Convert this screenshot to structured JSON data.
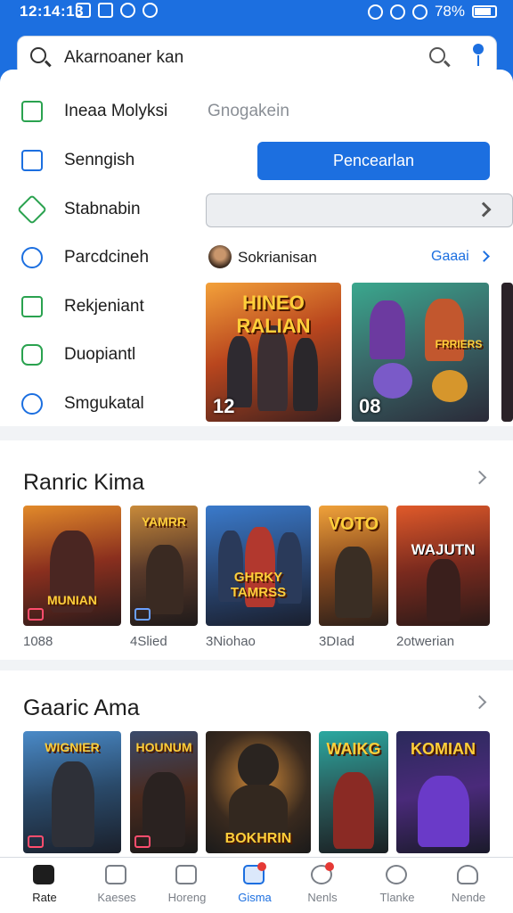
{
  "status": {
    "time": "12:14:13",
    "battery": "78%"
  },
  "search": {
    "value": "Akarnoaner kan"
  },
  "menu": [
    {
      "label": "Ineaa Molyksi",
      "icon": "home-icon"
    },
    {
      "label": "Senngish",
      "icon": "bag-icon"
    },
    {
      "label": "Stabnabin",
      "icon": "send-icon"
    },
    {
      "label": "Parcdcineh",
      "icon": "compass-icon"
    },
    {
      "label": "Rekjeniant",
      "icon": "folder-icon"
    },
    {
      "label": "Duopiantl",
      "icon": "badge-icon"
    },
    {
      "label": "Smgukatal",
      "icon": "location-icon"
    }
  ],
  "right": {
    "ghost": "Gnogakein",
    "primary": "Pencearlan",
    "publisher": "Sokrianisan",
    "more": "Gaaai"
  },
  "featured": [
    {
      "title": "HINEO RALIAN",
      "num": "12"
    },
    {
      "title": "FRRIERS",
      "num": "08"
    }
  ],
  "section1": {
    "title": "Ranric Kima",
    "items": [
      {
        "title": "MUNIAN",
        "caption": "1088"
      },
      {
        "title": "YAMRR",
        "caption": "4Slied"
      },
      {
        "title": "GHRKY TAMRSS",
        "caption": "3Niohao"
      },
      {
        "title": "VOTO",
        "caption": "3DIad"
      },
      {
        "title": "WAJUTN",
        "caption": "2otwerian"
      }
    ]
  },
  "section2": {
    "title": "Gaaric Ama",
    "items": [
      {
        "title": "WIGNIER"
      },
      {
        "title": "HOUNUM"
      },
      {
        "title": "BOKHRIN"
      },
      {
        "title": "WAIKG"
      },
      {
        "title": "KOMIAN"
      }
    ]
  },
  "nav": [
    {
      "label": "Rate"
    },
    {
      "label": "Kaeses"
    },
    {
      "label": "Horeng"
    },
    {
      "label": "Gisma"
    },
    {
      "label": "Nenls"
    },
    {
      "label": "Tlanke"
    },
    {
      "label": "Nende"
    }
  ]
}
